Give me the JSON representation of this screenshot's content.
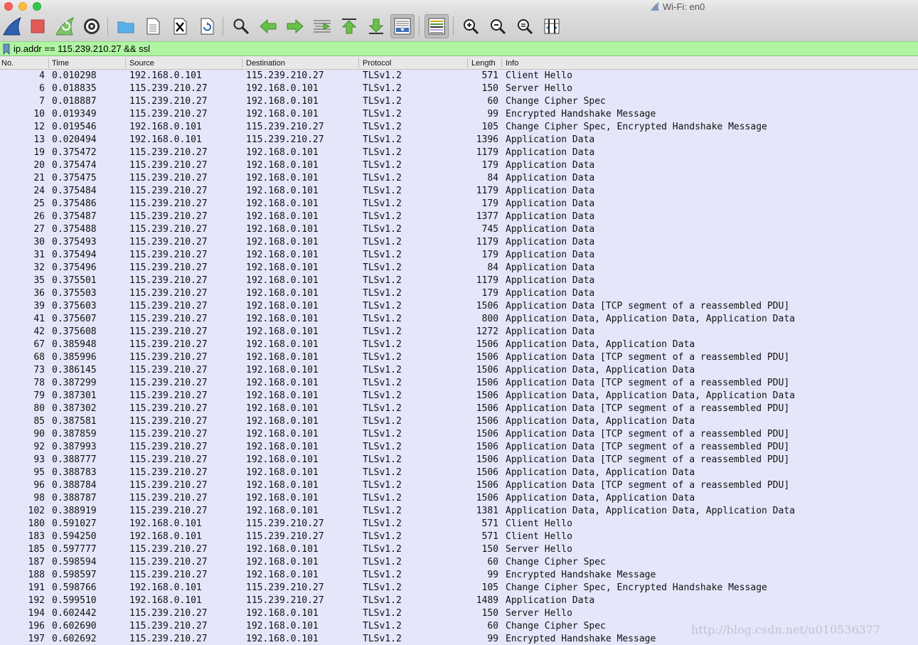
{
  "window": {
    "title": "Wi-Fi: en0"
  },
  "filter": {
    "value": "ip.addr == 115.239.210.27 && ssl"
  },
  "columns": {
    "no": "No.",
    "time": "Time",
    "source": "Source",
    "destination": "Destination",
    "protocol": "Protocol",
    "length": "Length",
    "info": "Info"
  },
  "packets": [
    {
      "no": "4",
      "time": "0.010298",
      "source": "192.168.0.101",
      "destination": "115.239.210.27",
      "protocol": "TLSv1.2",
      "length": "571",
      "info": "Client Hello"
    },
    {
      "no": "6",
      "time": "0.018835",
      "source": "115.239.210.27",
      "destination": "192.168.0.101",
      "protocol": "TLSv1.2",
      "length": "150",
      "info": "Server Hello"
    },
    {
      "no": "7",
      "time": "0.018887",
      "source": "115.239.210.27",
      "destination": "192.168.0.101",
      "protocol": "TLSv1.2",
      "length": "60",
      "info": "Change Cipher Spec"
    },
    {
      "no": "10",
      "time": "0.019349",
      "source": "115.239.210.27",
      "destination": "192.168.0.101",
      "protocol": "TLSv1.2",
      "length": "99",
      "info": "Encrypted Handshake Message"
    },
    {
      "no": "12",
      "time": "0.019546",
      "source": "192.168.0.101",
      "destination": "115.239.210.27",
      "protocol": "TLSv1.2",
      "length": "105",
      "info": "Change Cipher Spec, Encrypted Handshake Message"
    },
    {
      "no": "13",
      "time": "0.020494",
      "source": "192.168.0.101",
      "destination": "115.239.210.27",
      "protocol": "TLSv1.2",
      "length": "1396",
      "info": "Application Data"
    },
    {
      "no": "19",
      "time": "0.375472",
      "source": "115.239.210.27",
      "destination": "192.168.0.101",
      "protocol": "TLSv1.2",
      "length": "1179",
      "info": "Application Data"
    },
    {
      "no": "20",
      "time": "0.375474",
      "source": "115.239.210.27",
      "destination": "192.168.0.101",
      "protocol": "TLSv1.2",
      "length": "179",
      "info": "Application Data"
    },
    {
      "no": "21",
      "time": "0.375475",
      "source": "115.239.210.27",
      "destination": "192.168.0.101",
      "protocol": "TLSv1.2",
      "length": "84",
      "info": "Application Data"
    },
    {
      "no": "24",
      "time": "0.375484",
      "source": "115.239.210.27",
      "destination": "192.168.0.101",
      "protocol": "TLSv1.2",
      "length": "1179",
      "info": "Application Data"
    },
    {
      "no": "25",
      "time": "0.375486",
      "source": "115.239.210.27",
      "destination": "192.168.0.101",
      "protocol": "TLSv1.2",
      "length": "179",
      "info": "Application Data"
    },
    {
      "no": "26",
      "time": "0.375487",
      "source": "115.239.210.27",
      "destination": "192.168.0.101",
      "protocol": "TLSv1.2",
      "length": "1377",
      "info": "Application Data"
    },
    {
      "no": "27",
      "time": "0.375488",
      "source": "115.239.210.27",
      "destination": "192.168.0.101",
      "protocol": "TLSv1.2",
      "length": "745",
      "info": "Application Data"
    },
    {
      "no": "30",
      "time": "0.375493",
      "source": "115.239.210.27",
      "destination": "192.168.0.101",
      "protocol": "TLSv1.2",
      "length": "1179",
      "info": "Application Data"
    },
    {
      "no": "31",
      "time": "0.375494",
      "source": "115.239.210.27",
      "destination": "192.168.0.101",
      "protocol": "TLSv1.2",
      "length": "179",
      "info": "Application Data"
    },
    {
      "no": "32",
      "time": "0.375496",
      "source": "115.239.210.27",
      "destination": "192.168.0.101",
      "protocol": "TLSv1.2",
      "length": "84",
      "info": "Application Data"
    },
    {
      "no": "35",
      "time": "0.375501",
      "source": "115.239.210.27",
      "destination": "192.168.0.101",
      "protocol": "TLSv1.2",
      "length": "1179",
      "info": "Application Data"
    },
    {
      "no": "36",
      "time": "0.375503",
      "source": "115.239.210.27",
      "destination": "192.168.0.101",
      "protocol": "TLSv1.2",
      "length": "179",
      "info": "Application Data"
    },
    {
      "no": "39",
      "time": "0.375603",
      "source": "115.239.210.27",
      "destination": "192.168.0.101",
      "protocol": "TLSv1.2",
      "length": "1506",
      "info": "Application Data [TCP segment of a reassembled PDU]"
    },
    {
      "no": "41",
      "time": "0.375607",
      "source": "115.239.210.27",
      "destination": "192.168.0.101",
      "protocol": "TLSv1.2",
      "length": "800",
      "info": "Application Data, Application Data, Application Data"
    },
    {
      "no": "42",
      "time": "0.375608",
      "source": "115.239.210.27",
      "destination": "192.168.0.101",
      "protocol": "TLSv1.2",
      "length": "1272",
      "info": "Application Data"
    },
    {
      "no": "67",
      "time": "0.385948",
      "source": "115.239.210.27",
      "destination": "192.168.0.101",
      "protocol": "TLSv1.2",
      "length": "1506",
      "info": "Application Data, Application Data"
    },
    {
      "no": "68",
      "time": "0.385996",
      "source": "115.239.210.27",
      "destination": "192.168.0.101",
      "protocol": "TLSv1.2",
      "length": "1506",
      "info": "Application Data [TCP segment of a reassembled PDU]"
    },
    {
      "no": "73",
      "time": "0.386145",
      "source": "115.239.210.27",
      "destination": "192.168.0.101",
      "protocol": "TLSv1.2",
      "length": "1506",
      "info": "Application Data, Application Data"
    },
    {
      "no": "78",
      "time": "0.387299",
      "source": "115.239.210.27",
      "destination": "192.168.0.101",
      "protocol": "TLSv1.2",
      "length": "1506",
      "info": "Application Data [TCP segment of a reassembled PDU]"
    },
    {
      "no": "79",
      "time": "0.387301",
      "source": "115.239.210.27",
      "destination": "192.168.0.101",
      "protocol": "TLSv1.2",
      "length": "1506",
      "info": "Application Data, Application Data, Application Data"
    },
    {
      "no": "80",
      "time": "0.387302",
      "source": "115.239.210.27",
      "destination": "192.168.0.101",
      "protocol": "TLSv1.2",
      "length": "1506",
      "info": "Application Data [TCP segment of a reassembled PDU]"
    },
    {
      "no": "85",
      "time": "0.387581",
      "source": "115.239.210.27",
      "destination": "192.168.0.101",
      "protocol": "TLSv1.2",
      "length": "1506",
      "info": "Application Data, Application Data"
    },
    {
      "no": "90",
      "time": "0.387859",
      "source": "115.239.210.27",
      "destination": "192.168.0.101",
      "protocol": "TLSv1.2",
      "length": "1506",
      "info": "Application Data [TCP segment of a reassembled PDU]"
    },
    {
      "no": "92",
      "time": "0.387993",
      "source": "115.239.210.27",
      "destination": "192.168.0.101",
      "protocol": "TLSv1.2",
      "length": "1506",
      "info": "Application Data [TCP segment of a reassembled PDU]"
    },
    {
      "no": "93",
      "time": "0.388777",
      "source": "115.239.210.27",
      "destination": "192.168.0.101",
      "protocol": "TLSv1.2",
      "length": "1506",
      "info": "Application Data [TCP segment of a reassembled PDU]"
    },
    {
      "no": "95",
      "time": "0.388783",
      "source": "115.239.210.27",
      "destination": "192.168.0.101",
      "protocol": "TLSv1.2",
      "length": "1506",
      "info": "Application Data, Application Data"
    },
    {
      "no": "96",
      "time": "0.388784",
      "source": "115.239.210.27",
      "destination": "192.168.0.101",
      "protocol": "TLSv1.2",
      "length": "1506",
      "info": "Application Data [TCP segment of a reassembled PDU]"
    },
    {
      "no": "98",
      "time": "0.388787",
      "source": "115.239.210.27",
      "destination": "192.168.0.101",
      "protocol": "TLSv1.2",
      "length": "1506",
      "info": "Application Data, Application Data"
    },
    {
      "no": "102",
      "time": "0.388919",
      "source": "115.239.210.27",
      "destination": "192.168.0.101",
      "protocol": "TLSv1.2",
      "length": "1381",
      "info": "Application Data, Application Data, Application Data"
    },
    {
      "no": "180",
      "time": "0.591027",
      "source": "192.168.0.101",
      "destination": "115.239.210.27",
      "protocol": "TLSv1.2",
      "length": "571",
      "info": "Client Hello"
    },
    {
      "no": "183",
      "time": "0.594250",
      "source": "192.168.0.101",
      "destination": "115.239.210.27",
      "protocol": "TLSv1.2",
      "length": "571",
      "info": "Client Hello"
    },
    {
      "no": "185",
      "time": "0.597777",
      "source": "115.239.210.27",
      "destination": "192.168.0.101",
      "protocol": "TLSv1.2",
      "length": "150",
      "info": "Server Hello"
    },
    {
      "no": "187",
      "time": "0.598594",
      "source": "115.239.210.27",
      "destination": "192.168.0.101",
      "protocol": "TLSv1.2",
      "length": "60",
      "info": "Change Cipher Spec"
    },
    {
      "no": "188",
      "time": "0.598597",
      "source": "115.239.210.27",
      "destination": "192.168.0.101",
      "protocol": "TLSv1.2",
      "length": "99",
      "info": "Encrypted Handshake Message"
    },
    {
      "no": "191",
      "time": "0.598766",
      "source": "192.168.0.101",
      "destination": "115.239.210.27",
      "protocol": "TLSv1.2",
      "length": "105",
      "info": "Change Cipher Spec, Encrypted Handshake Message"
    },
    {
      "no": "192",
      "time": "0.599510",
      "source": "192.168.0.101",
      "destination": "115.239.210.27",
      "protocol": "TLSv1.2",
      "length": "1489",
      "info": "Application Data"
    },
    {
      "no": "194",
      "time": "0.602442",
      "source": "115.239.210.27",
      "destination": "192.168.0.101",
      "protocol": "TLSv1.2",
      "length": "150",
      "info": "Server Hello"
    },
    {
      "no": "196",
      "time": "0.602690",
      "source": "115.239.210.27",
      "destination": "192.168.0.101",
      "protocol": "TLSv1.2",
      "length": "60",
      "info": "Change Cipher Spec"
    },
    {
      "no": "197",
      "time": "0.602692",
      "source": "115.239.210.27",
      "destination": "192.168.0.101",
      "protocol": "TLSv1.2",
      "length": "99",
      "info": "Encrypted Handshake Message"
    }
  ],
  "watermark": "http://blog.csdn.net/u010536377",
  "colors": {
    "row_background": "#e6e6fa",
    "filter_valid": "#aff5a2"
  },
  "toolbar_icons": [
    "start-capture-icon",
    "stop-capture-icon",
    "restart-capture-icon",
    "capture-options-icon",
    "open-file-icon",
    "save-file-icon",
    "close-file-icon",
    "reload-file-icon",
    "find-packet-icon",
    "go-back-icon",
    "go-forward-icon",
    "go-to-packet-icon",
    "first-packet-icon",
    "last-packet-icon",
    "auto-scroll-icon",
    "colorize-icon",
    "zoom-in-icon",
    "zoom-out-icon",
    "normal-size-icon",
    "resize-columns-icon"
  ]
}
